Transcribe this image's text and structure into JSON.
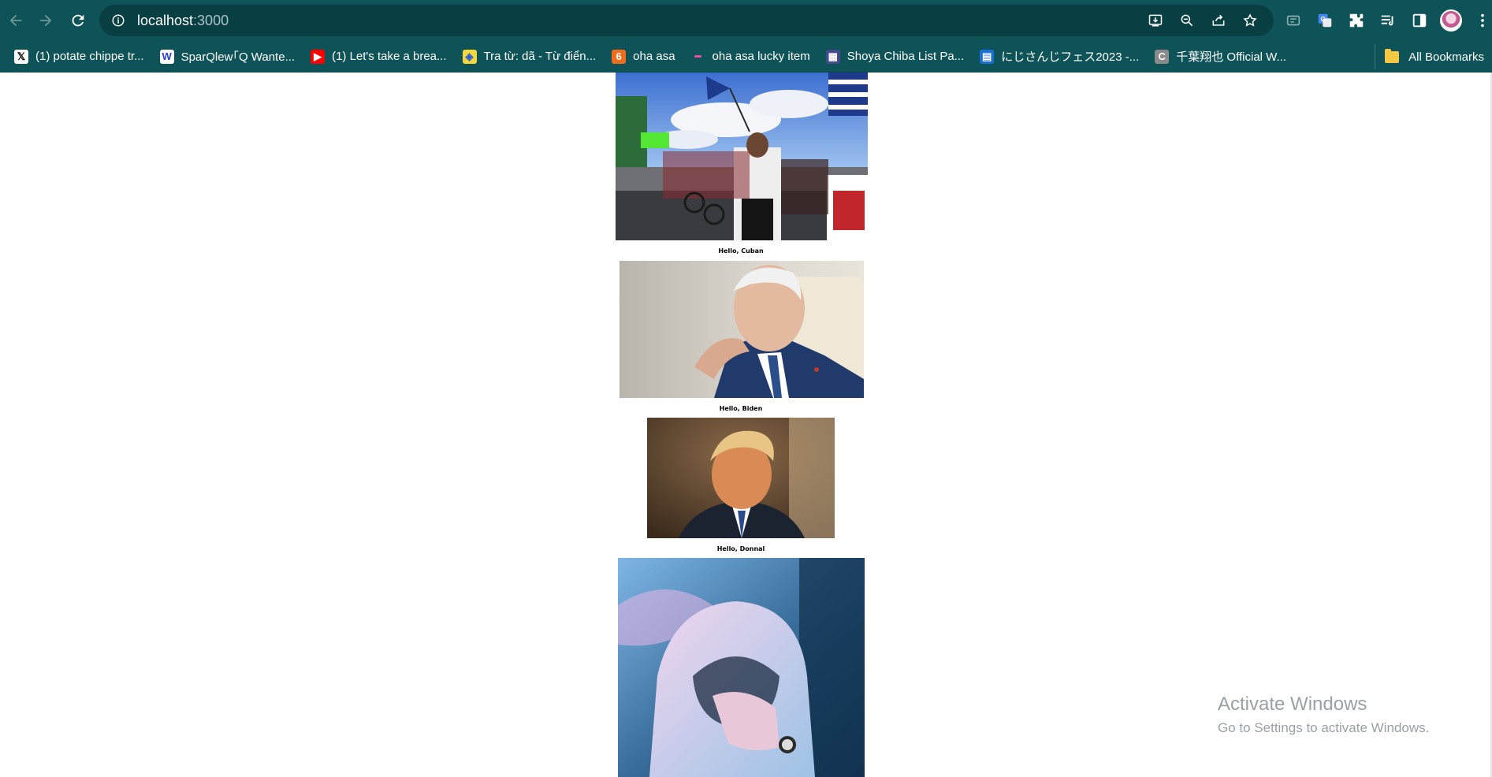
{
  "browser": {
    "url_host": "localhost",
    "url_port": ":3000",
    "icons": {
      "back": "back-arrow-icon",
      "forward": "forward-arrow-icon",
      "reload": "reload-icon",
      "site_info": "info-icon",
      "install": "install-app-icon",
      "zoom": "zoom-out-icon",
      "share": "share-icon",
      "bookmark": "star-icon"
    },
    "extensions": [
      "media-icon",
      "translate-icon",
      "puzzle-icon",
      "reading-list-icon",
      "side-panel-icon"
    ]
  },
  "bookmarks": [
    {
      "label": "(1) potate chippe tr...",
      "icon": "x-logo-icon",
      "fav": "𝕏",
      "fav_color": "#000000",
      "fav_bg": "#ffffff"
    },
    {
      "label": "SparQlew｢Q Wante...",
      "icon": "w-logo-icon",
      "fav": "W",
      "fav_color": "#2b3fd1",
      "fav_bg": "#ffffff"
    },
    {
      "label": "(1) Let's take a brea...",
      "icon": "youtube-icon",
      "fav": "▶",
      "fav_color": "#ffffff",
      "fav_bg": "#ff0000"
    },
    {
      "label": "Tra từ: dã - Từ điển...",
      "icon": "dictionary-icon",
      "fav": "◈",
      "fav_color": "#2a5bd7",
      "fav_bg": "#f5d73c"
    },
    {
      "label": "oha asa",
      "icon": "channel6-icon",
      "fav": "6",
      "fav_color": "#ffffff",
      "fav_bg": "#f36b1c"
    },
    {
      "label": "oha asa lucky item",
      "icon": "pink-stroke-icon",
      "fav": "━",
      "fav_color": "#ff4fa3",
      "fav_bg": "transparent"
    },
    {
      "label": "Shoya Chiba List Pa...",
      "icon": "pixel-art-icon",
      "fav": "▦",
      "fav_color": "#ffffff",
      "fav_bg": "#444a8c"
    },
    {
      "label": "にじさんじフェス2023 -...",
      "icon": "calendar-icon",
      "fav": "▤",
      "fav_color": "#ffffff",
      "fav_bg": "#1d6fd8"
    },
    {
      "label": "千葉翔也 Official W...",
      "icon": "c-logo-icon",
      "fav": "C",
      "fav_color": "#ffffff",
      "fav_bg": "#8a8a8a"
    }
  ],
  "all_bookmarks": "All Bookmarks",
  "captions": {
    "cuban": "Hello, Cuban",
    "biden": "Hello, Biden",
    "donnal": "Hello, Donnal"
  },
  "watermark": {
    "title": "Activate Windows",
    "subtitle": "Go to Settings to activate Windows."
  },
  "colors": {
    "chrome": "#0d5357",
    "omnibox": "#083f43"
  }
}
